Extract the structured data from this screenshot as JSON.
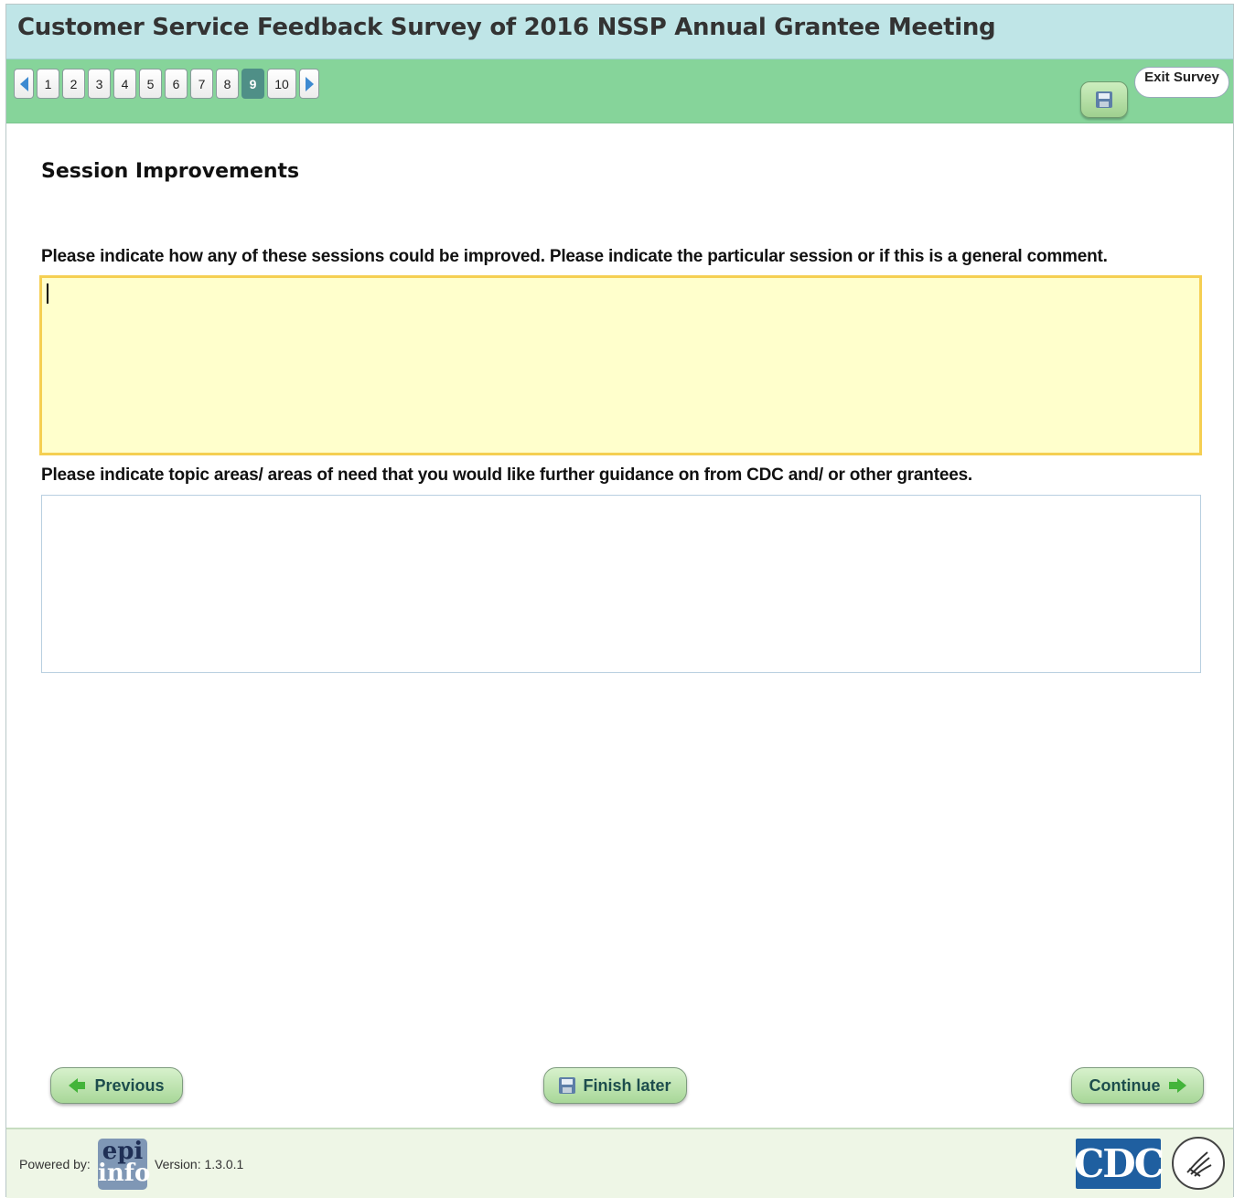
{
  "header": {
    "title": "Customer Service Feedback Survey of 2016 NSSP Annual Grantee Meeting"
  },
  "pager": {
    "pages": [
      "1",
      "2",
      "3",
      "4",
      "5",
      "6",
      "7",
      "8",
      "9",
      "10"
    ],
    "current": "9",
    "prev_icon": "triangle-left-icon",
    "next_icon": "triangle-right-icon"
  },
  "toolbar": {
    "save_icon": "floppy-disk-icon",
    "exit_label": "Exit Survey"
  },
  "section": {
    "title": "Session Improvements"
  },
  "questions": [
    {
      "label": "Please indicate how any of these sessions could be improved. Please indicate the particular session or if this is a general comment.",
      "value": ""
    },
    {
      "label": "Please indicate topic areas/ areas of need that you would like further guidance on from CDC and/ or other grantees.",
      "value": ""
    }
  ],
  "buttons": {
    "previous": "Previous",
    "finish_later": "Finish later",
    "continue": "Continue"
  },
  "footer": {
    "powered_by": "Powered by:",
    "epi_logo_top": "epi",
    "epi_logo_bottom": "info",
    "version": "Version: 1.3.0.1",
    "cdc_logo": "CDC"
  },
  "colors": {
    "title_bar": "#bfe5e7",
    "nav_bar": "#86d49a",
    "active_field": "#ffffcc",
    "active_field_border": "#f5cf52",
    "current_page": "#4f8f87"
  }
}
